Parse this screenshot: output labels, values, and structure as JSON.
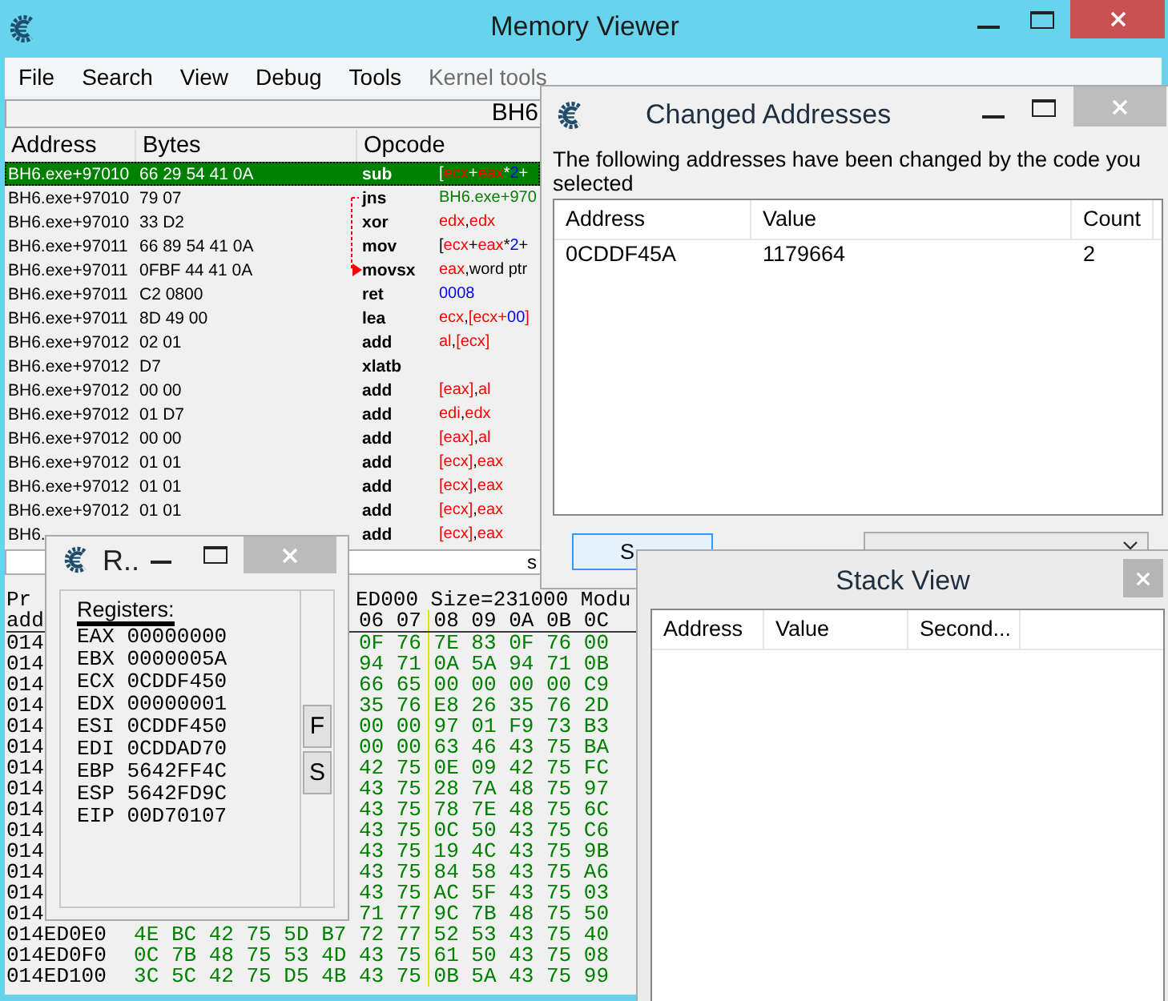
{
  "memory_viewer": {
    "title": "Memory Viewer",
    "menu": [
      {
        "label": "File",
        "disabled": false
      },
      {
        "label": "Search",
        "disabled": false
      },
      {
        "label": "View",
        "disabled": false
      },
      {
        "label": "Debug",
        "disabled": false
      },
      {
        "label": "Tools",
        "disabled": false
      },
      {
        "label": "Kernel tools",
        "disabled": true
      }
    ],
    "address_bar": "BH6",
    "disassembler": {
      "columns": [
        "Address",
        "Bytes",
        "Opcode"
      ],
      "rows": [
        {
          "address": "BH6.exe+97010",
          "bytes": "66 29 54 41 0A",
          "opcode": "sub",
          "operands": [
            {
              "text": "[",
              "kind": "plain"
            },
            {
              "text": "ecx",
              "kind": "register"
            },
            {
              "text": "+",
              "kind": "plain"
            },
            {
              "text": "eax",
              "kind": "register"
            },
            {
              "text": "*",
              "kind": "plain"
            },
            {
              "text": "2",
              "kind": "number"
            },
            {
              "text": "+",
              "kind": "plain"
            }
          ],
          "selected": true,
          "jump_from": false,
          "jump_to": false
        },
        {
          "address": "BH6.exe+97010",
          "bytes": "79 07",
          "opcode": "jns",
          "operands": [
            {
              "text": "BH6.exe+970",
              "kind": "symbol"
            }
          ],
          "selected": false,
          "jump_from": true,
          "jump_to": false
        },
        {
          "address": "BH6.exe+97010",
          "bytes": "33 D2",
          "opcode": "xor",
          "operands": [
            {
              "text": "edx",
              "kind": "register"
            },
            {
              "text": ",",
              "kind": "plain"
            },
            {
              "text": "edx",
              "kind": "register"
            }
          ],
          "selected": false,
          "jump_from": false,
          "jump_to": false
        },
        {
          "address": "BH6.exe+97011",
          "bytes": "66 89 54 41 0A",
          "opcode": "mov",
          "operands": [
            {
              "text": "[",
              "kind": "plain"
            },
            {
              "text": "ecx",
              "kind": "register"
            },
            {
              "text": "+",
              "kind": "plain"
            },
            {
              "text": "eax",
              "kind": "register"
            },
            {
              "text": "*",
              "kind": "plain"
            },
            {
              "text": "2",
              "kind": "number"
            },
            {
              "text": "+",
              "kind": "plain"
            }
          ],
          "selected": false,
          "jump_from": false,
          "jump_to": false
        },
        {
          "address": "BH6.exe+97011",
          "bytes": "0FBF 44 41 0A",
          "opcode": "movsx",
          "operands": [
            {
              "text": "eax",
              "kind": "register"
            },
            {
              "text": ",word ptr",
              "kind": "plain"
            }
          ],
          "selected": false,
          "jump_from": false,
          "jump_to": true
        },
        {
          "address": "BH6.exe+97011",
          "bytes": "C2 0800",
          "opcode": "ret",
          "operands": [
            {
              "text": "0008",
              "kind": "number"
            }
          ],
          "selected": false,
          "jump_from": false,
          "jump_to": false
        },
        {
          "address": "BH6.exe+97011",
          "bytes": "8D 49 00",
          "opcode": "lea",
          "operands": [
            {
              "text": "ecx",
              "kind": "register"
            },
            {
              "text": ",",
              "kind": "plain"
            },
            {
              "text": "[ecx+",
              "kind": "register"
            },
            {
              "text": "00",
              "kind": "number"
            },
            {
              "text": "]",
              "kind": "register"
            }
          ],
          "selected": false,
          "jump_from": false,
          "jump_to": false
        },
        {
          "address": "BH6.exe+97012",
          "bytes": "02 01",
          "opcode": "add",
          "operands": [
            {
              "text": "al",
              "kind": "register"
            },
            {
              "text": ",",
              "kind": "plain"
            },
            {
              "text": "[ecx]",
              "kind": "register"
            }
          ],
          "selected": false,
          "jump_from": false,
          "jump_to": false
        },
        {
          "address": "BH6.exe+97012",
          "bytes": "D7",
          "opcode": "xlatb",
          "selected": false,
          "jump_from": false,
          "jump_to": false
        },
        {
          "address": "BH6.exe+97012",
          "bytes": "00 00",
          "opcode": "add",
          "operands": [
            {
              "text": "[eax]",
              "kind": "register"
            },
            {
              "text": ",",
              "kind": "plain"
            },
            {
              "text": "al",
              "kind": "register"
            }
          ],
          "selected": false,
          "jump_from": false,
          "jump_to": false
        },
        {
          "address": "BH6.exe+97012",
          "bytes": "01 D7",
          "opcode": "add",
          "operands": [
            {
              "text": "edi",
              "kind": "register"
            },
            {
              "text": ",",
              "kind": "plain"
            },
            {
              "text": "edx",
              "kind": "register"
            }
          ],
          "selected": false,
          "jump_from": false,
          "jump_to": false
        },
        {
          "address": "BH6.exe+97012",
          "bytes": "00 00",
          "opcode": "add",
          "operands": [
            {
              "text": "[eax]",
              "kind": "register"
            },
            {
              "text": ",",
              "kind": "plain"
            },
            {
              "text": "al",
              "kind": "register"
            }
          ],
          "selected": false,
          "jump_from": false,
          "jump_to": false
        },
        {
          "address": "BH6.exe+97012",
          "bytes": "01 01",
          "opcode": "add",
          "operands": [
            {
              "text": "[ecx]",
              "kind": "register"
            },
            {
              "text": ",",
              "kind": "plain"
            },
            {
              "text": "eax",
              "kind": "register"
            }
          ],
          "selected": false,
          "jump_from": false,
          "jump_to": false
        },
        {
          "address": "BH6.exe+97012",
          "bytes": "01 01",
          "opcode": "add",
          "operands": [
            {
              "text": "[ecx]",
              "kind": "register"
            },
            {
              "text": ",",
              "kind": "plain"
            },
            {
              "text": "eax",
              "kind": "register"
            }
          ],
          "selected": false,
          "jump_from": false,
          "jump_to": false
        },
        {
          "address": "BH6.exe+97012",
          "bytes": "01 01",
          "opcode": "add",
          "operands": [
            {
              "text": "[ecx]",
              "kind": "register"
            },
            {
              "text": ",",
              "kind": "plain"
            },
            {
              "text": "eax",
              "kind": "register"
            }
          ],
          "selected": false,
          "jump_from": false,
          "jump_to": false
        },
        {
          "address": "BH6.",
          "opcode": "add",
          "operands": [
            {
              "text": "[ecx]",
              "kind": "register"
            },
            {
              "text": ",",
              "kind": "plain"
            },
            {
              "text": "eax",
              "kind": "register"
            }
          ],
          "selected": false,
          "jump_from": false,
          "jump_to": false
        }
      ]
    },
    "status_field": {
      "value": "s"
    },
    "hex_view": {
      "info_left": "Pr",
      "info_right": "ED000 Size=231000 Modu",
      "header_left": "add",
      "header_offsets": "06 07 08 09 0A 0B 0C",
      "rows": [
        {
          "address": "014",
          "bytes": "0F 76 7E 83 0F 76 00"
        },
        {
          "address": "014",
          "bytes": "94 71 0A 5A 94 71 0B"
        },
        {
          "address": "014",
          "bytes": "66 65 00 00 00 00 C9"
        },
        {
          "address": "014",
          "bytes": "35 76 E8 26 35 76 2D"
        },
        {
          "address": "014",
          "bytes": "00 00 97 01 F9 73 B3"
        },
        {
          "address": "014",
          "bytes": "00 00 63 46 43 75 BA"
        },
        {
          "address": "014",
          "bytes": "42 75 0E 09 42 75 FC"
        },
        {
          "address": "014",
          "bytes": "43 75 28 7A 48 75 97"
        },
        {
          "address": "014",
          "bytes": "43 75 78 7E 48 75 6C"
        },
        {
          "address": "014",
          "bytes": "43 75 0C 50 43 75 C6"
        },
        {
          "address": "014",
          "bytes": "43 75 19 4C 43 75 9B"
        },
        {
          "address": "014",
          "bytes": "43 75 84 58 43 75 A6"
        },
        {
          "address": "014",
          "bytes": "43 75 AC 5F 43 75 03"
        },
        {
          "address": "014",
          "bytes": "71 77 9C 7B 48 75 50"
        },
        {
          "address": "014ED0E0",
          "bytes": "4E BC 42 75 5D B7 72 77 52 53 43 75 40"
        },
        {
          "address": "014ED0F0",
          "bytes": "0C 7B 48 75 53 4D 43 75 61 50 43 75 08"
        },
        {
          "address": "014ED100",
          "bytes": "3C 5C 42 75 D5 4B 43 75 0B 5A 43 75 99"
        }
      ]
    }
  },
  "registers_window": {
    "title": "R..",
    "heading": "Registers:",
    "registers": [
      {
        "name": "EAX",
        "value": "00000000"
      },
      {
        "name": "EBX",
        "value": "0000005A"
      },
      {
        "name": "ECX",
        "value": "0CDDF450"
      },
      {
        "name": "EDX",
        "value": "00000001"
      },
      {
        "name": "ESI",
        "value": "0CDDF450"
      },
      {
        "name": "EDI",
        "value": "0CDDAD70"
      },
      {
        "name": "EBP",
        "value": "5642FF4C"
      },
      {
        "name": "ESP",
        "value": "5642FD9C"
      },
      {
        "name": "EIP",
        "value": "00D70107"
      }
    ],
    "side_buttons": [
      "F",
      "S"
    ]
  },
  "changed_addresses_window": {
    "title": "Changed Addresses",
    "message": "The following addresses have been changed by the code you selected",
    "columns": [
      "Address",
      "Value",
      "Count"
    ],
    "rows": [
      {
        "address": "0CDDF45A",
        "value": "1179664",
        "count": "2"
      }
    ],
    "action_button": "S"
  },
  "stack_view_window": {
    "title": "Stack View",
    "columns": [
      "Address",
      "Value",
      "Second..."
    ]
  }
}
